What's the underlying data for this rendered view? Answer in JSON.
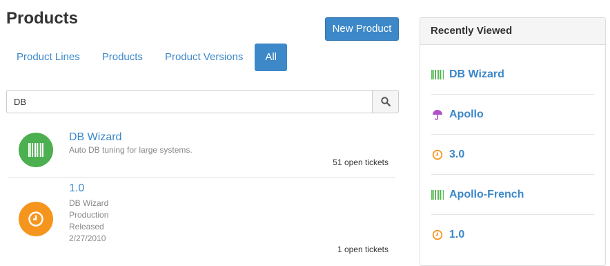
{
  "header": {
    "title": "Products",
    "new_button": "New Product"
  },
  "tabs": [
    {
      "label": "Product Lines",
      "active": false
    },
    {
      "label": "Products",
      "active": false
    },
    {
      "label": "Product Versions",
      "active": false
    },
    {
      "label": "All",
      "active": true
    }
  ],
  "search": {
    "value": "DB",
    "icon": "search-icon"
  },
  "results": [
    {
      "title": "DB Wizard",
      "description": "Auto DB tuning for large systems.",
      "tickets": "51 open tickets",
      "icon": "barcode-icon",
      "color": "#4caf50"
    },
    {
      "title": "1.0",
      "lines": [
        "DB Wizard",
        "Production",
        "Released",
        "2/27/2010"
      ],
      "tickets": "1 open tickets",
      "icon": "clock-icon",
      "color": "#f6951e"
    }
  ],
  "recent": {
    "title": "Recently Viewed",
    "items": [
      {
        "label": "DB Wizard",
        "icon": "barcode-icon"
      },
      {
        "label": "Apollo",
        "icon": "umbrella-icon"
      },
      {
        "label": "3.0",
        "icon": "clock-icon"
      },
      {
        "label": "Apollo-French",
        "icon": "barcode-icon"
      },
      {
        "label": "1.0",
        "icon": "clock-icon"
      }
    ]
  },
  "colors": {
    "accent": "#3c88c8",
    "green": "#4caf50",
    "orange": "#f6951e",
    "purple": "#b04fc8"
  }
}
